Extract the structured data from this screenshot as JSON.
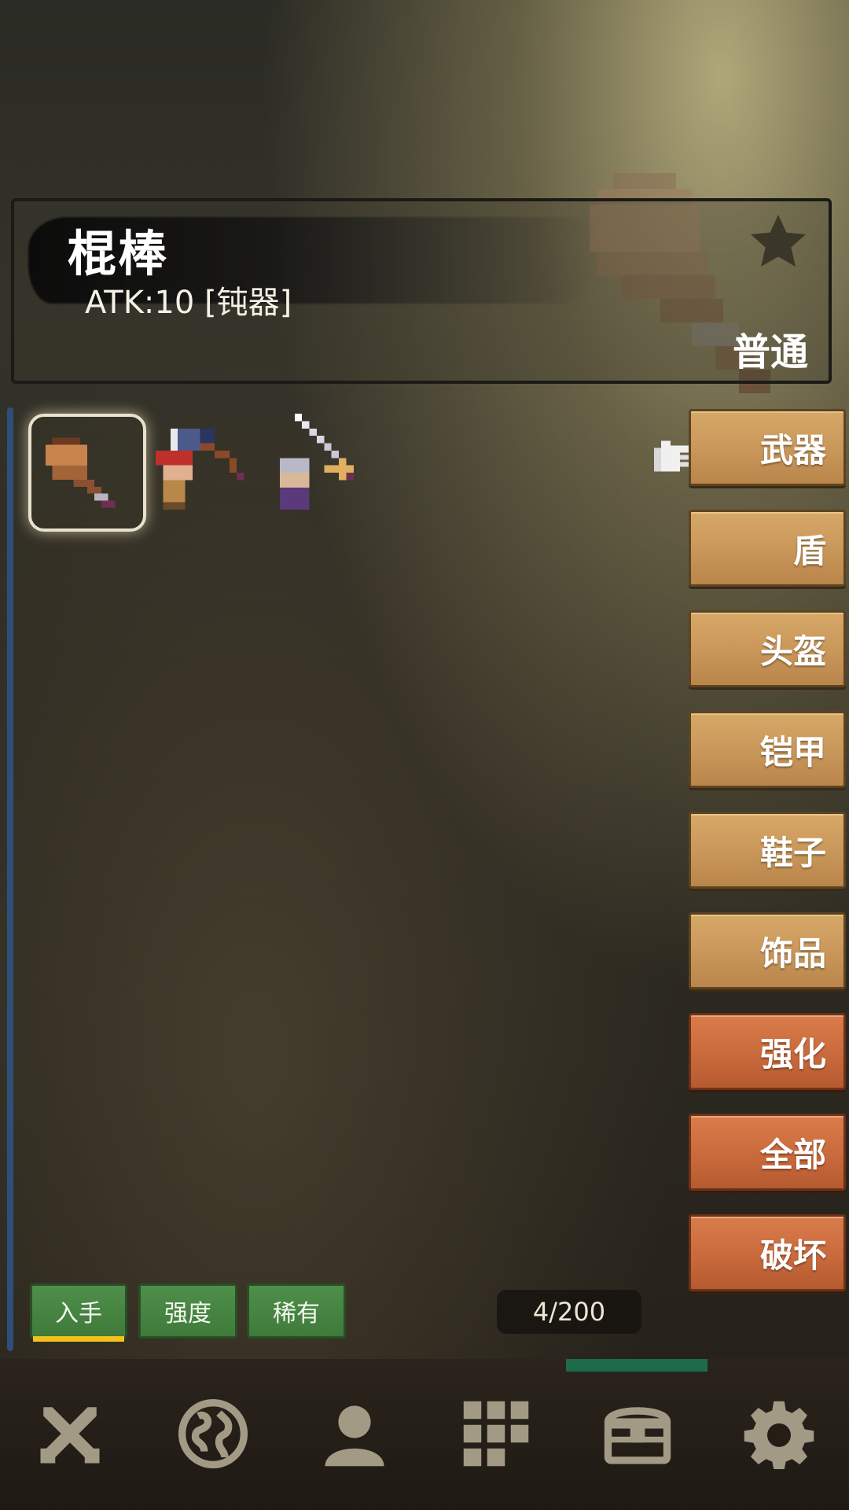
{
  "selected_item": {
    "name": "棍棒",
    "stat": "ATK:10 [钝器]",
    "rarity": "普通"
  },
  "inventory": {
    "slots": [
      {
        "icon": "club-icon",
        "selected": true
      },
      {
        "icon": "axe-with-red-haired-hero-icon",
        "selected": false
      },
      {
        "icon": "sword-with-silver-haired-hero-icon",
        "selected": false
      }
    ],
    "count": "4/200"
  },
  "categories": [
    {
      "label": "武器",
      "type": "category",
      "active": true
    },
    {
      "label": "盾",
      "type": "category"
    },
    {
      "label": "头盔",
      "type": "category"
    },
    {
      "label": "铠甲",
      "type": "category"
    },
    {
      "label": "鞋子",
      "type": "category"
    },
    {
      "label": "饰品",
      "type": "category"
    },
    {
      "label": "强化",
      "type": "action"
    },
    {
      "label": "全部",
      "type": "action"
    },
    {
      "label": "破坏",
      "type": "action"
    }
  ],
  "sort_buttons": [
    {
      "label": "入手",
      "active": true
    },
    {
      "label": "强度"
    },
    {
      "label": "稀有"
    }
  ],
  "bottom_nav": [
    {
      "icon": "crossed-swords-icon"
    },
    {
      "icon": "globe-icon"
    },
    {
      "icon": "person-icon"
    },
    {
      "icon": "grid-icon"
    },
    {
      "icon": "treasure-chest-icon"
    },
    {
      "icon": "gear-icon"
    }
  ],
  "colors": {
    "category_button": "#c9965a",
    "action_button": "#c96a3c",
    "sort_button": "#3f7a3a",
    "sort_active_underline": "#f2c21a",
    "progress": "#1d6b4a"
  }
}
